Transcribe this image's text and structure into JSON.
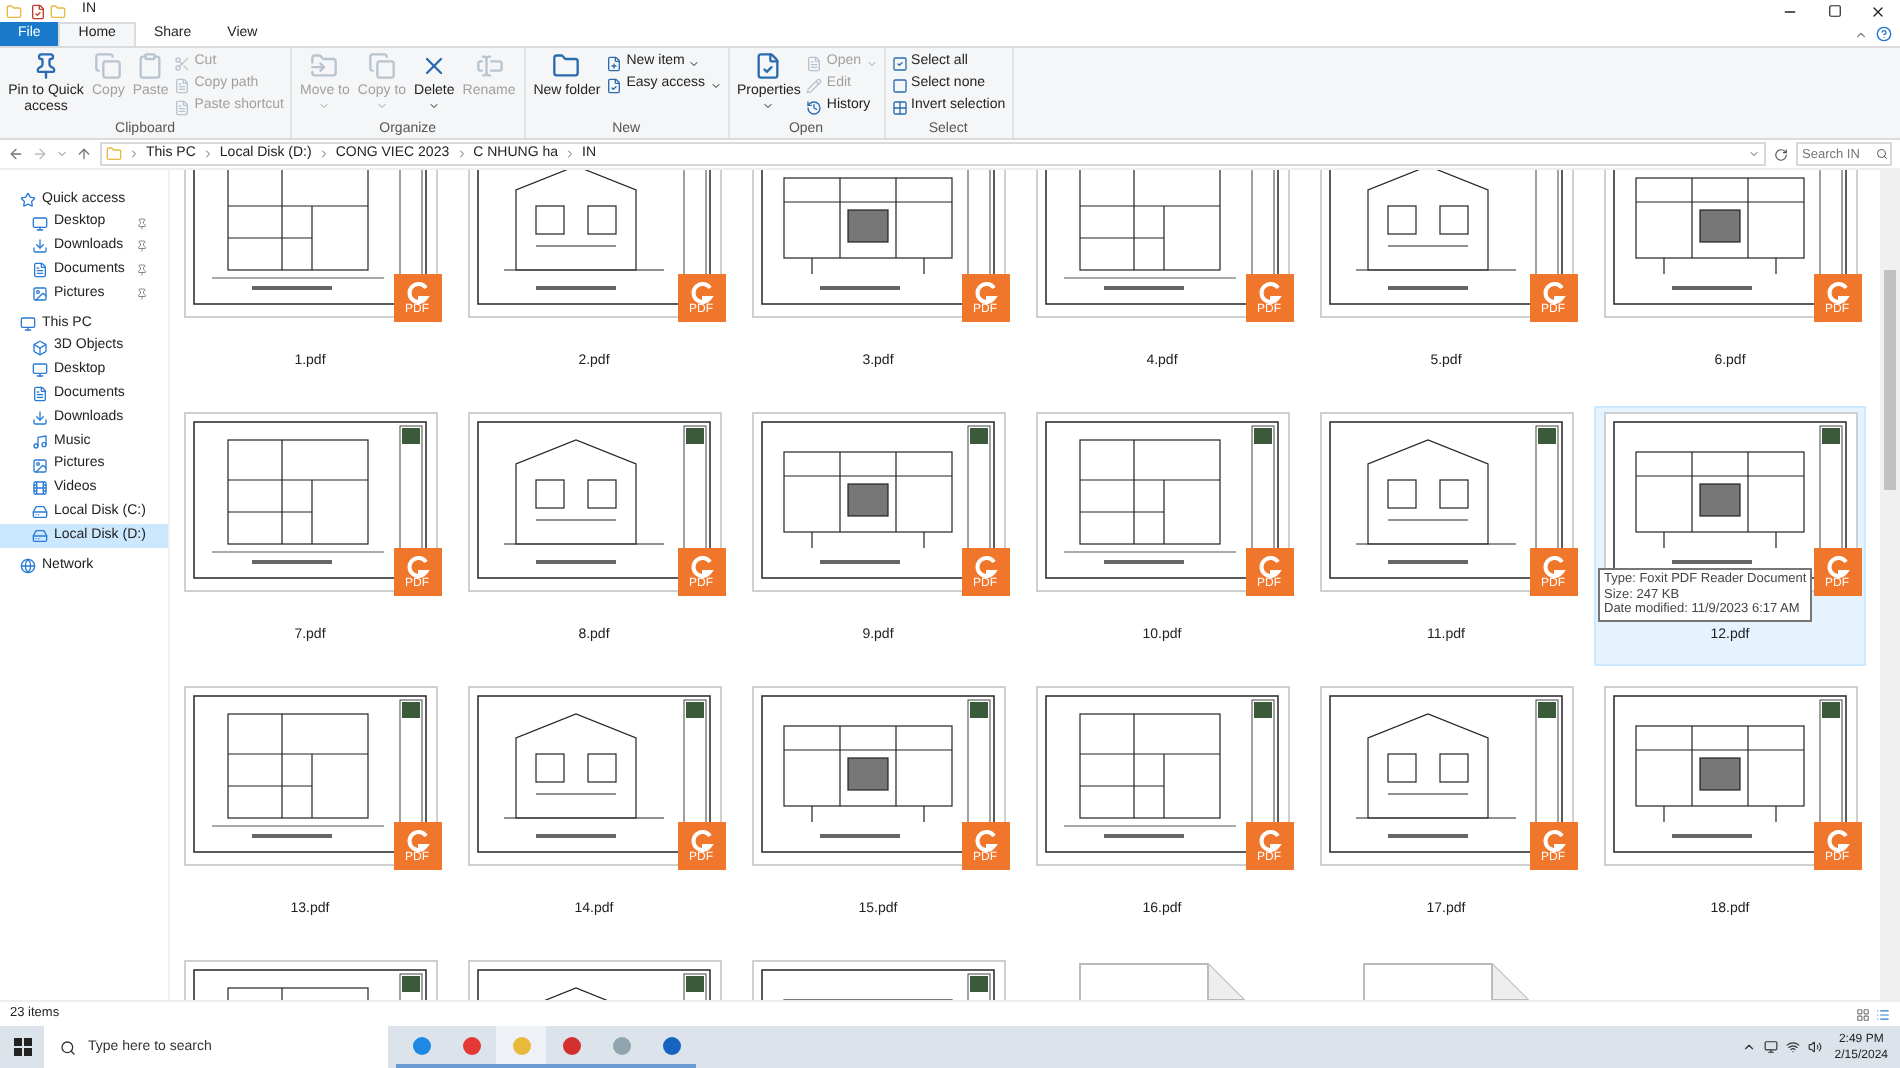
{
  "window": {
    "title": "IN"
  },
  "tabs": [
    {
      "label": "File",
      "kind": "file",
      "selected": false
    },
    {
      "label": "Home",
      "kind": "tab",
      "selected": true
    },
    {
      "label": "Share",
      "kind": "tab",
      "selected": false
    },
    {
      "label": "View",
      "kind": "tab",
      "selected": false
    }
  ],
  "ribbon": [
    {
      "label": "Clipboard",
      "buttons": [
        {
          "label": "Pin to Quick access",
          "kind": "large",
          "disabled": false
        },
        {
          "label": "Copy",
          "kind": "large",
          "disabled": true
        },
        {
          "label": "Paste",
          "kind": "large",
          "disabled": true
        },
        {
          "label": "Cut",
          "kind": "small",
          "disabled": true
        },
        {
          "label": "Copy path",
          "kind": "small",
          "disabled": true
        },
        {
          "label": "Paste shortcut",
          "kind": "small",
          "disabled": true
        }
      ]
    },
    {
      "label": "Organize",
      "buttons": [
        {
          "label": "Move to",
          "kind": "large",
          "disabled": true,
          "dropdown": true
        },
        {
          "label": "Copy to",
          "kind": "large",
          "disabled": true,
          "dropdown": true
        },
        {
          "label": "Delete",
          "kind": "large",
          "disabled": false,
          "dropdown": true
        },
        {
          "label": "Rename",
          "kind": "large",
          "disabled": true
        }
      ]
    },
    {
      "label": "New",
      "buttons": [
        {
          "label": "New folder",
          "kind": "large",
          "disabled": false
        },
        {
          "label": "New item",
          "kind": "small",
          "disabled": false,
          "dropdown": true
        },
        {
          "label": "Easy access",
          "kind": "small",
          "disabled": false,
          "dropdown": true
        }
      ]
    },
    {
      "label": "Open",
      "buttons": [
        {
          "label": "Properties",
          "kind": "large",
          "disabled": false,
          "dropdown": true
        },
        {
          "label": "Open",
          "kind": "small",
          "disabled": true,
          "dropdown": true
        },
        {
          "label": "Edit",
          "kind": "small",
          "disabled": true
        },
        {
          "label": "History",
          "kind": "small",
          "disabled": false
        }
      ]
    },
    {
      "label": "Select",
      "buttons": [
        {
          "label": "Select all",
          "kind": "small",
          "disabled": false
        },
        {
          "label": "Select none",
          "kind": "small",
          "disabled": false
        },
        {
          "label": "Invert selection",
          "kind": "small",
          "disabled": false
        }
      ]
    }
  ],
  "address_bar": {
    "path": [
      "This PC",
      "Local Disk (D:)",
      "CONG VIEC 2023",
      "C NHUNG ha",
      "IN"
    ],
    "search": {
      "placeholder": "Search IN"
    }
  },
  "sidebar": {
    "items": [
      {
        "label": "Quick access",
        "selected": false,
        "children": [
          {
            "label": "Desktop",
            "selected": false,
            "pinned": true
          },
          {
            "label": "Downloads",
            "selected": false,
            "pinned": true
          },
          {
            "label": "Documents",
            "selected": false,
            "pinned": true
          },
          {
            "label": "Pictures",
            "selected": false,
            "pinned": true
          }
        ]
      },
      {
        "label": "This PC",
        "selected": false,
        "children": [
          {
            "label": "3D Objects",
            "selected": false,
            "pinned": false
          },
          {
            "label": "Desktop",
            "selected": false,
            "pinned": false
          },
          {
            "label": "Documents",
            "selected": false,
            "pinned": false
          },
          {
            "label": "Downloads",
            "selected": false,
            "pinned": false
          },
          {
            "label": "Music",
            "selected": false,
            "pinned": false
          },
          {
            "label": "Pictures",
            "selected": false,
            "pinned": false
          },
          {
            "label": "Videos",
            "selected": false,
            "pinned": false
          },
          {
            "label": "Local Disk (C:)",
            "selected": false,
            "pinned": false
          },
          {
            "label": "Local Disk (D:)",
            "selected": true,
            "pinned": false
          }
        ]
      },
      {
        "label": "Network",
        "selected": false
      }
    ]
  },
  "files": [
    {
      "name": "1.pdf",
      "kind": "pdf",
      "badge": "PDF",
      "selected": false
    },
    {
      "name": "2.pdf",
      "kind": "pdf",
      "badge": "PDF",
      "selected": false
    },
    {
      "name": "3.pdf",
      "kind": "pdf",
      "badge": "PDF",
      "selected": false
    },
    {
      "name": "4.pdf",
      "kind": "pdf",
      "badge": "PDF",
      "selected": false
    },
    {
      "name": "5.pdf",
      "kind": "pdf",
      "badge": "PDF",
      "selected": false
    },
    {
      "name": "6.pdf",
      "kind": "pdf",
      "badge": "PDF",
      "selected": false
    },
    {
      "name": "7.pdf",
      "kind": "pdf",
      "badge": "PDF",
      "selected": false
    },
    {
      "name": "8.pdf",
      "kind": "pdf",
      "badge": "PDF",
      "selected": false
    },
    {
      "name": "9.pdf",
      "kind": "pdf",
      "badge": "PDF",
      "selected": false
    },
    {
      "name": "10.pdf",
      "kind": "pdf",
      "badge": "PDF",
      "selected": false
    },
    {
      "name": "11.pdf",
      "kind": "pdf",
      "badge": "PDF",
      "selected": false
    },
    {
      "name": "12.pdf",
      "kind": "pdf",
      "badge": "PDF",
      "selected": true,
      "tooltip": [
        "Type: Foxit PDF Reader Document",
        "Size: 247 KB",
        "Date modified: 11/9/2023 6:17 AM"
      ]
    },
    {
      "name": "13.pdf",
      "kind": "pdf",
      "badge": "PDF",
      "selected": false
    },
    {
      "name": "14.pdf",
      "kind": "pdf",
      "badge": "PDF",
      "selected": false
    },
    {
      "name": "15.pdf",
      "kind": "pdf",
      "badge": "PDF",
      "selected": false
    },
    {
      "name": "16.pdf",
      "kind": "pdf",
      "badge": "PDF",
      "selected": false
    },
    {
      "name": "17.pdf",
      "kind": "pdf",
      "badge": "PDF",
      "selected": false
    },
    {
      "name": "18.pdf",
      "kind": "pdf",
      "badge": "PDF",
      "selected": false
    },
    {
      "kind": "pdf",
      "selected": false
    },
    {
      "kind": "pdf",
      "selected": false
    },
    {
      "kind": "pdf",
      "selected": false
    },
    {
      "kind": "document",
      "selected": false
    },
    {
      "kind": "document",
      "selected": false
    }
  ],
  "status_bar": {
    "count": "23 items"
  },
  "taskbar": {
    "search": {
      "placeholder": "Type here to search"
    },
    "time": "2:49 PM",
    "date": "2/15/2024"
  }
}
